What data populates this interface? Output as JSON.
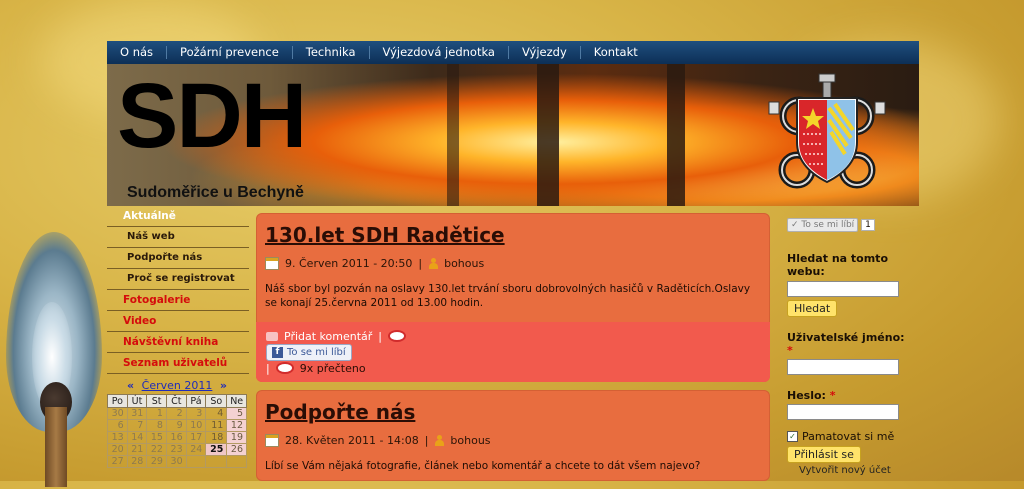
{
  "nav": [
    "O nás",
    "Požární prevence",
    "Technika",
    "Výjezdová jednotka",
    "Výjezdy",
    "Kontakt"
  ],
  "banner": {
    "title": "SDH",
    "subtitle": "Sudoměřice u Bechyně"
  },
  "sidebar": {
    "items": [
      {
        "label": "Aktuálně",
        "type": "top"
      },
      {
        "label": "Náš web",
        "type": "sub"
      },
      {
        "label": "Podpořte nás",
        "type": "sub"
      },
      {
        "label": "Proč se registrovat",
        "type": "sub"
      },
      {
        "label": "Fotogalerie",
        "type": "red"
      },
      {
        "label": "Video",
        "type": "red"
      },
      {
        "label": "Návštěvní kniha",
        "type": "red"
      },
      {
        "label": "Seznam uživatelů",
        "type": "red"
      }
    ]
  },
  "calendar": {
    "month": "Červen 2011",
    "prev": "«",
    "next": "»",
    "days": [
      "Po",
      "Út",
      "St",
      "Čt",
      "Pá",
      "So",
      "Ne"
    ],
    "weeks": [
      [
        "30",
        "31",
        "1",
        "2",
        "3",
        "4",
        "5"
      ],
      [
        "6",
        "7",
        "8",
        "9",
        "10",
        "11",
        "12"
      ],
      [
        "13",
        "14",
        "15",
        "16",
        "17",
        "18",
        "19"
      ],
      [
        "20",
        "21",
        "22",
        "23",
        "24",
        "25",
        "26"
      ],
      [
        "27",
        "28",
        "29",
        "30",
        "",
        "",
        ""
      ]
    ],
    "today": "25"
  },
  "posts": [
    {
      "title": "130.let SDH Radětice",
      "date": "9. Červen 2011 - 20:50",
      "author": "bohous",
      "body": "Náš sbor byl pozván na oslavy 130.let trvání sboru dobrovolných hasičů v Raděticích.Oslavy se konají 25.června 2011 od 13.00 hodin.",
      "add_comment": "Přidat komentář",
      "like": "To se mi líbí",
      "reads": "9x přečteno"
    },
    {
      "title": "Podpořte nás",
      "date": "28. Květen 2011 - 14:08",
      "author": "bohous",
      "body": "Líbí se Vám nějaká fotografie, článek nebo komentář a chcete to dát všem najevo?"
    }
  ],
  "right": {
    "like_label": "To se mi líbí",
    "like_count": "1",
    "search_title": "Hledat na tomto webu:",
    "search_button": "Hledat",
    "username_label": "Uživatelské jméno:",
    "required_mark": "*",
    "password_label": "Heslo:",
    "remember_label": "Pamatovat si mě",
    "login_button": "Přihlásit se",
    "create_account": "Vytvořit nový účet"
  },
  "colors": {
    "nav_bg": "#0d2f56",
    "post_bg": "#e86d3f",
    "accent_red": "#d50c0c",
    "button_yellow": "#ffe36a"
  }
}
